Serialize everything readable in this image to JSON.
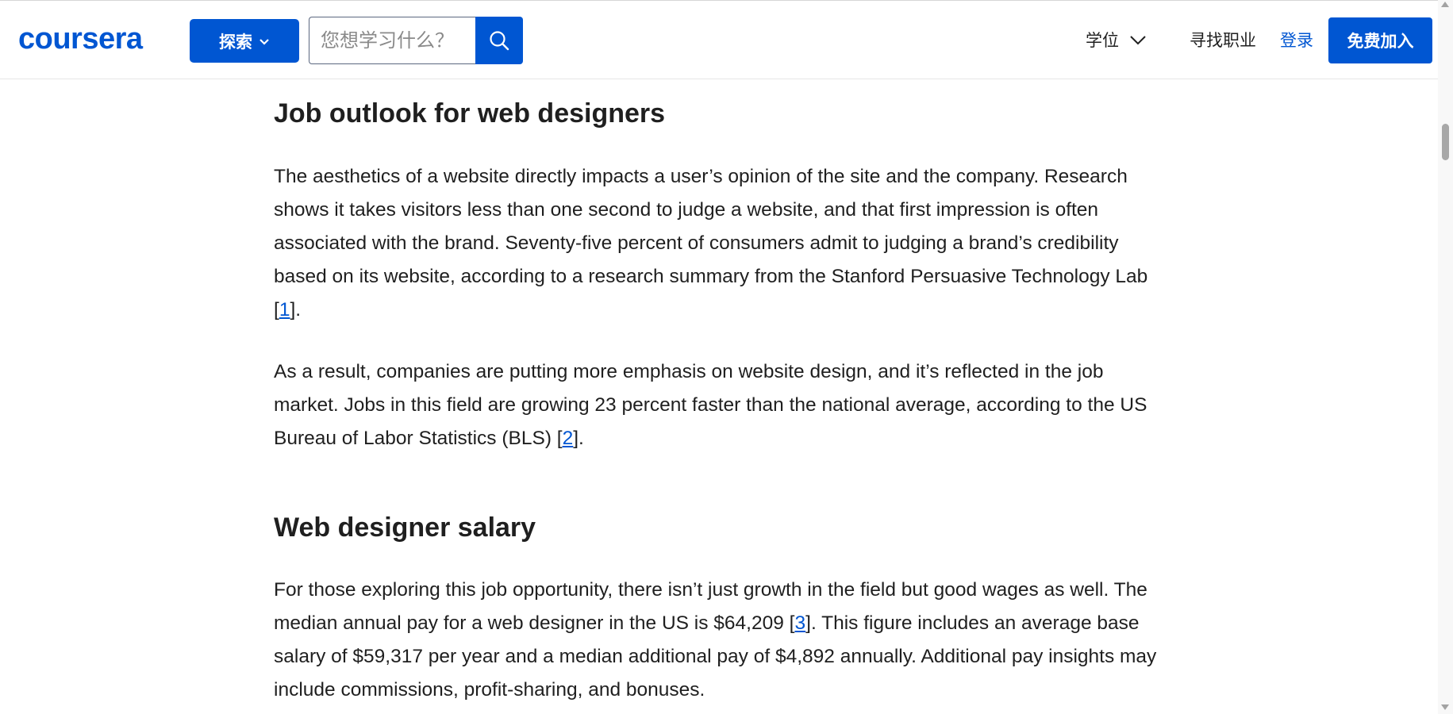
{
  "header": {
    "logo_text": "coursera",
    "explore_label": "探索",
    "search_placeholder": "您想学习什么？",
    "degree_label": "学位",
    "careers_label": "寻找职业",
    "login_label": "登录",
    "join_label": "免费加入",
    "icons": {
      "explore_chevron": "chevron-down-icon",
      "search": "search-icon",
      "degree_chevron": "chevron-down-icon"
    }
  },
  "article": {
    "outlook_heading": "Job outlook for web designers",
    "p1_text": "The aesthetics of a website directly impacts a user’s opinion of the site and the company. Research shows it takes visitors less than one second to judge a website, and that first impression is often associated with the brand. Seventy-five percent of consumers admit to judging a brand’s credibility based on its website, according to a research summary from the Stanford Persuasive Technology Lab ",
    "p1_ref": "1",
    "p1_end": ".",
    "p2_text": "As a result, companies are putting more emphasis on website design, and it’s reflected in the job market. Jobs in this field are growing 23 percent faster than the national average, according to the US Bureau of Labor Statistics (BLS) ",
    "p2_ref": "2",
    "p2_end": ".",
    "salary_heading": "Web designer salary",
    "p3_text_a": "For those exploring this job opportunity, there isn’t just growth in the field but good wages as well. The median annual pay for a web designer in the US is $64,209 ",
    "p3_ref": "3",
    "p3_text_b": ". This figure includes an average base salary of $59,317 per year and a median additional pay of $4,892 annually. Additional pay insights may include commissions, profit-sharing, and bonuses."
  },
  "colors": {
    "brand_blue": "#0056d2",
    "text": "#1f1f1f"
  }
}
